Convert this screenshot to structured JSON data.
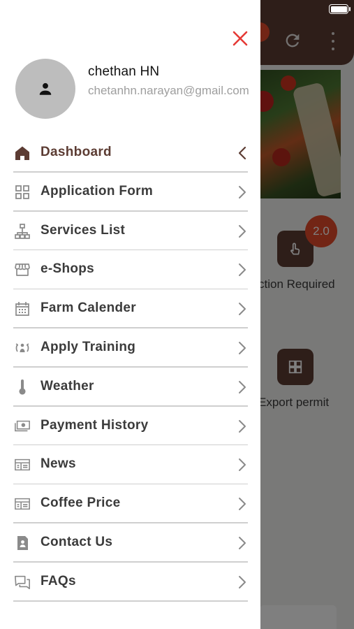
{
  "colors": {
    "accent_brown": "#5c3c33",
    "close_red": "#e53935",
    "badge_orange": "#e54b2a",
    "text_dark": "#3b3b3b",
    "text_muted": "#9e9e9e",
    "divider": "#cfcfcf"
  },
  "drawer": {
    "close_icon": "close-x-icon",
    "profile": {
      "avatar_icon": "person-icon",
      "name": "chethan HN",
      "email": "chetanhn.narayan@gmail.com"
    },
    "menu": [
      {
        "label": "Dashboard",
        "icon": "home-icon",
        "active": true,
        "chevron": "chevron-left-icon"
      },
      {
        "label": "Application Form",
        "icon": "grid-icon",
        "chevron": "chevron-right-icon"
      },
      {
        "label": "Services List",
        "icon": "sitemap-icon",
        "chevron": "chevron-right-icon"
      },
      {
        "label": "e-Shops",
        "icon": "store-icon",
        "chevron": "chevron-right-icon"
      },
      {
        "label": "Farm Calender",
        "icon": "calendar-icon",
        "chevron": "chevron-right-icon"
      },
      {
        "label": "Apply Training",
        "icon": "training-icon",
        "chevron": "chevron-right-icon"
      },
      {
        "label": "Weather",
        "icon": "thermometer-icon",
        "chevron": "chevron-right-icon"
      },
      {
        "label": "Payment History",
        "icon": "money-icon",
        "chevron": "chevron-right-icon"
      },
      {
        "label": "News",
        "icon": "newspaper-icon",
        "chevron": "chevron-right-icon"
      },
      {
        "label": "Coffee Price",
        "icon": "newspaper-icon",
        "chevron": "chevron-right-icon"
      },
      {
        "label": "Contact Us",
        "icon": "contact-icon",
        "chevron": "chevron-right-icon"
      },
      {
        "label": "FAQs",
        "icon": "forum-icon",
        "chevron": "chevron-right-icon"
      }
    ]
  },
  "background": {
    "badge": "2.0",
    "tile_labels": [
      "ction Required",
      "Export permit"
    ]
  }
}
